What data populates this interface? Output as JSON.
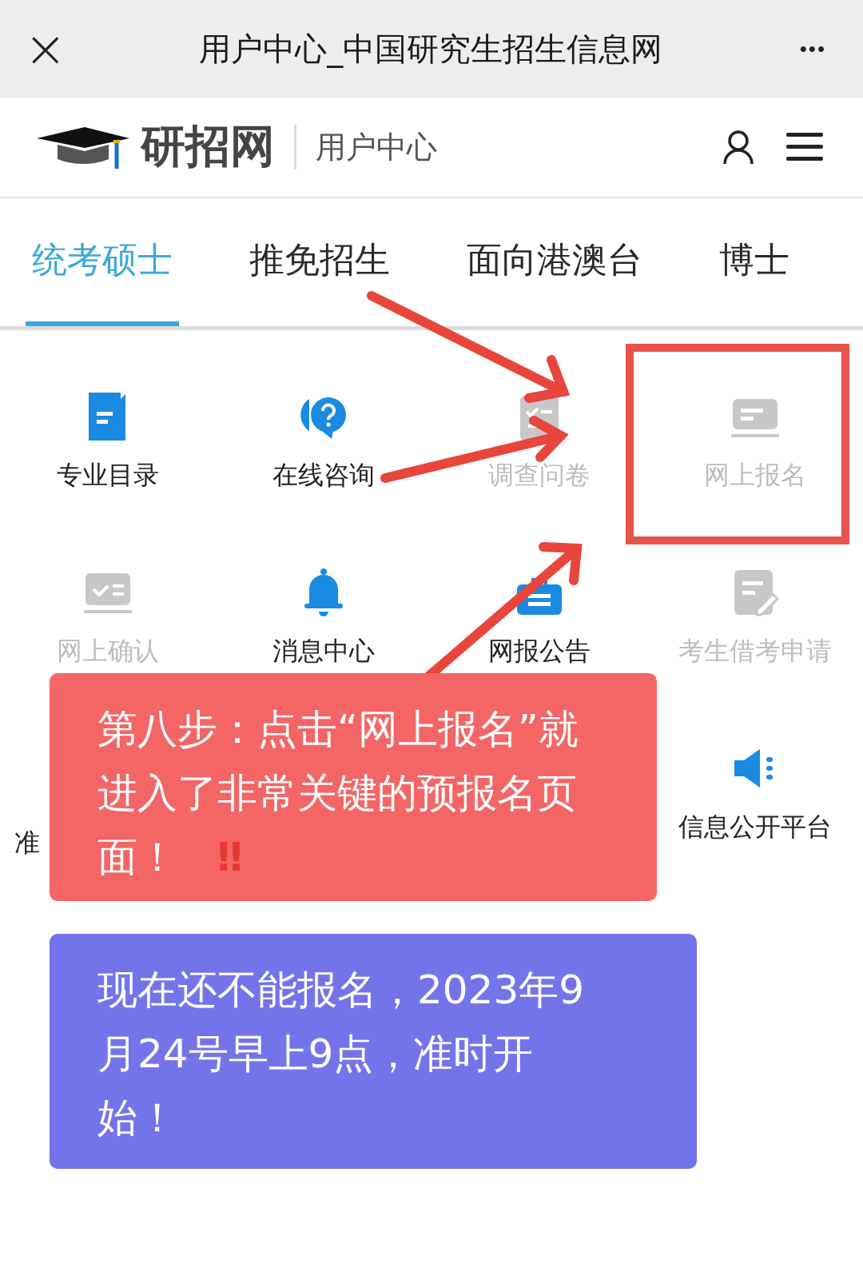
{
  "window": {
    "title": "用户中心_中国研究生招生信息网",
    "close": "×",
    "more": "•••"
  },
  "header": {
    "logo": "研招网",
    "subtitle": "用户中心"
  },
  "tabs": [
    {
      "label": "统考硕士",
      "selected": true
    },
    {
      "label": "推免招生",
      "selected": false
    },
    {
      "label": "面向港澳台",
      "selected": false
    },
    {
      "label": "博士",
      "selected": false
    }
  ],
  "grid": [
    {
      "kind": "item",
      "label": "专业目录",
      "disabled": false
    },
    {
      "kind": "item",
      "label": "在线咨询",
      "disabled": false
    },
    {
      "kind": "item",
      "label": "调查问卷",
      "disabled": true
    },
    {
      "kind": "item",
      "label": "网上报名",
      "disabled": true
    },
    {
      "kind": "item",
      "label": "网上确认",
      "disabled": true
    },
    {
      "kind": "item",
      "label": "消息中心",
      "disabled": false
    },
    {
      "kind": "item",
      "label": "网报公告",
      "disabled": false
    },
    {
      "kind": "item",
      "label": "考生借考申请",
      "disabled": true
    },
    {
      "kind": "partial",
      "label": "准"
    },
    {
      "kind": "item",
      "label": "信息公开平台",
      "disabled": false
    }
  ],
  "callouts": [
    {
      "kind": "red",
      "text": "第八步：点击“网上报名”就进入了非常关键的预报名页面！",
      "mark": "‼"
    },
    {
      "kind": "purple",
      "text": "现在还不能报名，2023年9月24号早上9点，准时开始！"
    }
  ]
}
